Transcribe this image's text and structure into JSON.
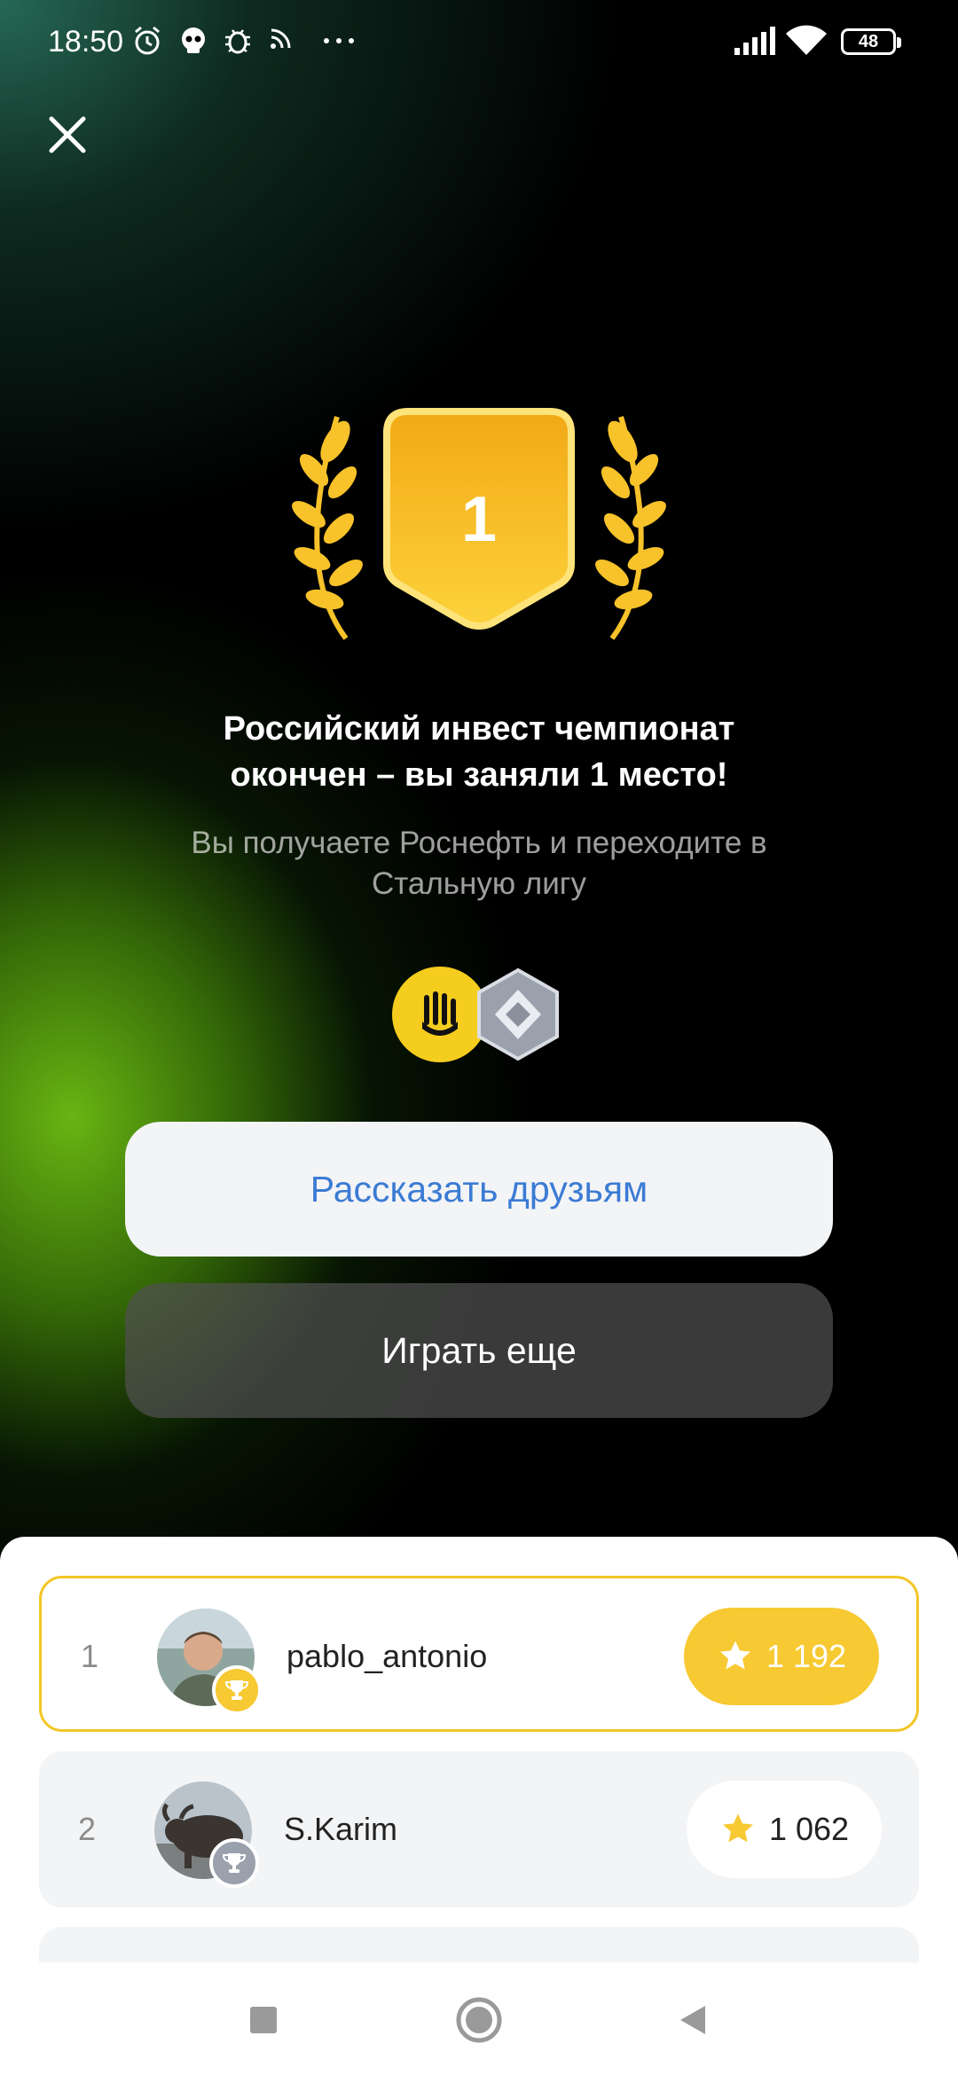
{
  "status_bar": {
    "time": "18:50",
    "battery": "48",
    "icons": [
      "alarm-icon",
      "skull-icon",
      "bug-icon",
      "cast-icon",
      "more-icon",
      "signal-icon",
      "wifi-icon",
      "battery-icon"
    ]
  },
  "badge": {
    "place": "1"
  },
  "result": {
    "title": "Российский инвест чемпионат\nокончен – вы заняли 1 место!",
    "subtitle": "Вы получаете Роснефть и переходите в\nСтальную лигу"
  },
  "rewards": [
    "rosneft-coin-icon",
    "steel-league-icon"
  ],
  "buttons": {
    "share": "Рассказать друзьям",
    "play_again": "Играть еще"
  },
  "leaderboard": [
    {
      "rank": "1",
      "name": "pablo_antonio",
      "score": "1 192"
    },
    {
      "rank": "2",
      "name": "S.Karim",
      "score": "1 062"
    }
  ],
  "colors": {
    "accent_gold": "#f7c932",
    "share_text": "#3b7bd4"
  }
}
